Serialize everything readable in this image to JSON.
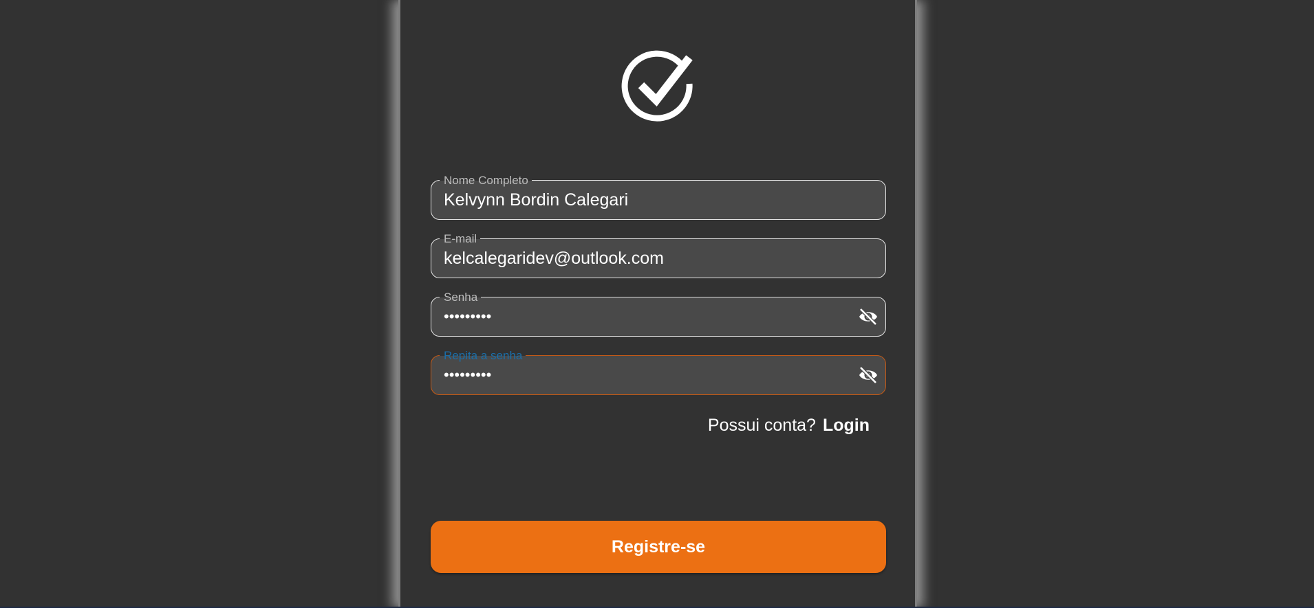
{
  "form": {
    "full_name": {
      "label": "Nome Completo",
      "value": "Kelvynn Bordin Calegari"
    },
    "email": {
      "label": "E-mail",
      "value": "kelcalegaridev@outlook.com"
    },
    "password": {
      "label": "Senha",
      "value": "•••••••••"
    },
    "password_confirm": {
      "label": "Repita a senha",
      "value": "•••••••••"
    }
  },
  "login_prompt": {
    "question": "Possui conta?",
    "link_label": "Login"
  },
  "register_button": {
    "label": "Registre-se"
  },
  "colors": {
    "background": "#323232",
    "field_background": "#494949",
    "accent": "#ec7013",
    "focused_label": "#1b6ea8"
  },
  "icons": {
    "logo": "check-circle-icon",
    "password_toggle": "eye-off-icon"
  }
}
